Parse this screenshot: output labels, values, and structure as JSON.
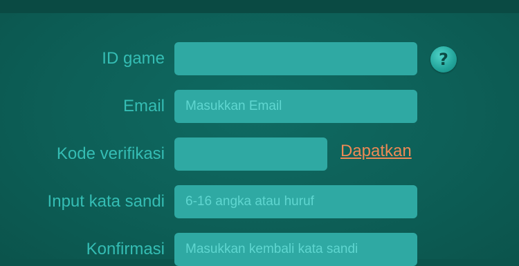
{
  "form": {
    "game_id": {
      "label": "ID game",
      "value": "",
      "placeholder": "",
      "help_icon": "question-mark-icon"
    },
    "email": {
      "label": "Email",
      "value": "",
      "placeholder": "Masukkan Email"
    },
    "verification_code": {
      "label": "Kode verifikasi",
      "value": "",
      "placeholder": "",
      "get_code_link": "Dapatkan"
    },
    "password": {
      "label": "Input kata sandi",
      "value": "",
      "placeholder": "6-16 angka atau huruf"
    },
    "confirm_password": {
      "label": "Konfirmasi",
      "value": "",
      "placeholder": "Masukkan kembali kata sandi"
    }
  },
  "colors": {
    "background": "#0b544c",
    "field": "#2fa9a3",
    "label": "#35bdb4",
    "link": "#ee8a55"
  }
}
